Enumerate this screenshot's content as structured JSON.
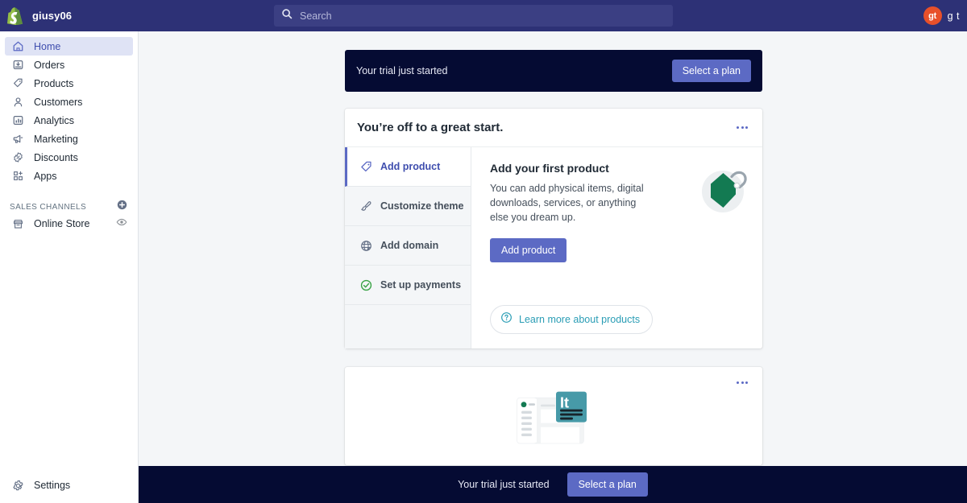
{
  "topbar": {
    "logo_icon": "shopify-bag-icon",
    "store_name": "giusy06",
    "search": {
      "icon": "search-icon",
      "placeholder": "Search",
      "value": ""
    },
    "user": {
      "avatar_initials": "gt",
      "avatar_color": "#e8502a",
      "name": "g t"
    },
    "background_color": "#2d3176"
  },
  "sidebar": {
    "items": [
      {
        "label": "Home",
        "icon": "home-icon",
        "active": true
      },
      {
        "label": "Orders",
        "icon": "orders-inbox-icon",
        "active": false
      },
      {
        "label": "Products",
        "icon": "products-tag-icon",
        "active": false
      },
      {
        "label": "Customers",
        "icon": "customers-person-icon",
        "active": false
      },
      {
        "label": "Analytics",
        "icon": "analytics-bar-chart-icon",
        "active": false
      },
      {
        "label": "Marketing",
        "icon": "marketing-megaphone-icon",
        "active": false
      },
      {
        "label": "Discounts",
        "icon": "discounts-percent-icon",
        "active": false
      },
      {
        "label": "Apps",
        "icon": "apps-grid-plus-icon",
        "active": false
      }
    ],
    "sales_channels": {
      "title": "SALES CHANNELS",
      "add_icon": "plus-circle-icon",
      "channels": [
        {
          "label": "Online Store",
          "icon": "storefront-icon",
          "trailing_icon": "eye-icon"
        }
      ]
    },
    "settings": {
      "label": "Settings",
      "icon": "gear-icon"
    }
  },
  "main": {
    "trial_banner": {
      "message": "Your trial just started",
      "button_label": "Select a plan",
      "background_color": "#050b33",
      "button_color": "#5c6ac4"
    },
    "onboarding_card": {
      "title": "You’re off to a great start.",
      "menu_icon": "kebab-menu-icon",
      "tasks": [
        {
          "label": "Add product",
          "icon": "tag-icon",
          "selected": true,
          "complete": false
        },
        {
          "label": "Customize theme",
          "icon": "paintbrush-icon",
          "selected": false,
          "complete": false
        },
        {
          "label": "Add domain",
          "icon": "globe-icon",
          "selected": false,
          "complete": false
        },
        {
          "label": "Set up payments",
          "icon": "check-circle-icon",
          "selected": false,
          "complete": true
        }
      ],
      "detail": {
        "title": "Add your first product",
        "description": "You can add physical items, digital downloads, services, or anything else you dream up.",
        "primary_button": "Add product",
        "learn_more": {
          "label": "Learn more about products",
          "icon": "question-circle-icon",
          "color": "#2a9db5"
        },
        "illustration": "green-product-tag-illustration"
      }
    },
    "second_card": {
      "menu_icon": "kebab-menu-icon",
      "illustration": "translate-dashboard-illustration",
      "illustration_badge_text": "It"
    }
  },
  "sticky_footer": {
    "message": "Your trial just started",
    "button_label": "Select a plan",
    "background_color": "#050b33"
  }
}
